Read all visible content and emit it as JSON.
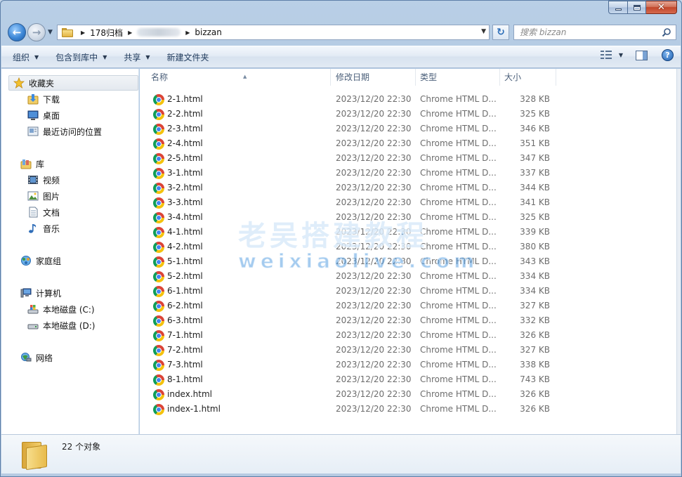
{
  "window": {
    "buttons": {
      "minimize": "minimize",
      "maximize": "maximize",
      "close": "✕"
    }
  },
  "address": {
    "crumbs": [
      "178归档",
      "bizzan"
    ],
    "search_placeholder": "搜索 bizzan"
  },
  "toolbar": {
    "organize": "组织",
    "include_in_library": "包含到库中",
    "share": "共享",
    "new_folder": "新建文件夹"
  },
  "nav": {
    "favorites": "收藏夹",
    "downloads": "下载",
    "desktop": "桌面",
    "recent": "最近访问的位置",
    "libraries": "库",
    "videos": "视频",
    "pictures": "图片",
    "documents": "文档",
    "music": "音乐",
    "homegroup": "家庭组",
    "computer": "计算机",
    "drive_c": "本地磁盘 (C:)",
    "drive_d": "本地磁盘 (D:)",
    "network": "网络"
  },
  "columns": {
    "name": "名称",
    "date": "修改日期",
    "type": "类型",
    "size": "大小"
  },
  "files": [
    {
      "name": "2-1.html",
      "date": "2023/12/20 22:30",
      "type": "Chrome HTML D...",
      "size": "328 KB"
    },
    {
      "name": "2-2.html",
      "date": "2023/12/20 22:30",
      "type": "Chrome HTML D...",
      "size": "325 KB"
    },
    {
      "name": "2-3.html",
      "date": "2023/12/20 22:30",
      "type": "Chrome HTML D...",
      "size": "346 KB"
    },
    {
      "name": "2-4.html",
      "date": "2023/12/20 22:30",
      "type": "Chrome HTML D...",
      "size": "351 KB"
    },
    {
      "name": "2-5.html",
      "date": "2023/12/20 22:30",
      "type": "Chrome HTML D...",
      "size": "347 KB"
    },
    {
      "name": "3-1.html",
      "date": "2023/12/20 22:30",
      "type": "Chrome HTML D...",
      "size": "337 KB"
    },
    {
      "name": "3-2.html",
      "date": "2023/12/20 22:30",
      "type": "Chrome HTML D...",
      "size": "344 KB"
    },
    {
      "name": "3-3.html",
      "date": "2023/12/20 22:30",
      "type": "Chrome HTML D...",
      "size": "341 KB"
    },
    {
      "name": "3-4.html",
      "date": "2023/12/20 22:30",
      "type": "Chrome HTML D...",
      "size": "325 KB"
    },
    {
      "name": "4-1.html",
      "date": "2023/12/20 22:30",
      "type": "Chrome HTML D...",
      "size": "339 KB"
    },
    {
      "name": "4-2.html",
      "date": "2023/12/20 22:30",
      "type": "Chrome HTML D...",
      "size": "380 KB"
    },
    {
      "name": "5-1.html",
      "date": "2023/12/20 22:30",
      "type": "Chrome HTML D...",
      "size": "343 KB"
    },
    {
      "name": "5-2.html",
      "date": "2023/12/20 22:30",
      "type": "Chrome HTML D...",
      "size": "334 KB"
    },
    {
      "name": "6-1.html",
      "date": "2023/12/20 22:30",
      "type": "Chrome HTML D...",
      "size": "334 KB"
    },
    {
      "name": "6-2.html",
      "date": "2023/12/20 22:30",
      "type": "Chrome HTML D...",
      "size": "327 KB"
    },
    {
      "name": "6-3.html",
      "date": "2023/12/20 22:30",
      "type": "Chrome HTML D...",
      "size": "332 KB"
    },
    {
      "name": "7-1.html",
      "date": "2023/12/20 22:30",
      "type": "Chrome HTML D...",
      "size": "326 KB"
    },
    {
      "name": "7-2.html",
      "date": "2023/12/20 22:30",
      "type": "Chrome HTML D...",
      "size": "327 KB"
    },
    {
      "name": "7-3.html",
      "date": "2023/12/20 22:30",
      "type": "Chrome HTML D...",
      "size": "338 KB"
    },
    {
      "name": "8-1.html",
      "date": "2023/12/20 22:30",
      "type": "Chrome HTML D...",
      "size": "743 KB"
    },
    {
      "name": "index.html",
      "date": "2023/12/20 22:30",
      "type": "Chrome HTML D...",
      "size": "326 KB"
    },
    {
      "name": "index-1.html",
      "date": "2023/12/20 22:30",
      "type": "Chrome HTML D...",
      "size": "326 KB"
    }
  ],
  "watermark": {
    "cn": "老吴搭建教程",
    "en": "weixiaolive.com"
  },
  "status": {
    "item_count": "22 个对象"
  },
  "icons": {
    "file": "chrome-html-icon",
    "folder": "folder-icon"
  }
}
